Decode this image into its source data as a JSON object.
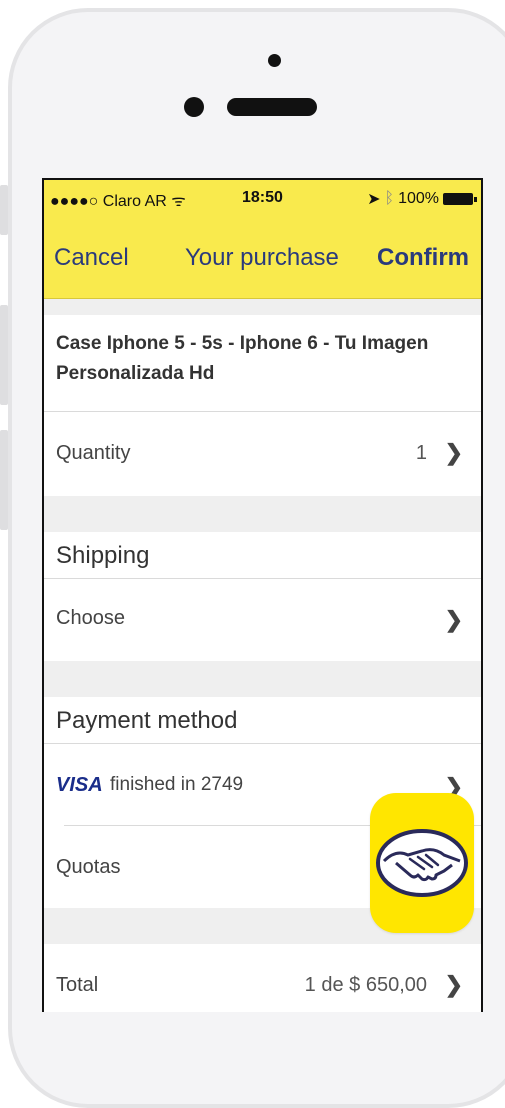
{
  "status_bar": {
    "carrier": "●●●●○ Claro AR",
    "time": "18:50",
    "battery": "100%"
  },
  "navbar": {
    "cancel": "Cancel",
    "title": "Your purchase",
    "confirm": "Confirm"
  },
  "product": {
    "title": "Case Iphone 5 - 5s - Iphone 6 - Tu Imagen Personalizada Hd"
  },
  "quantity": {
    "label": "Quantity",
    "value": "1"
  },
  "shipping": {
    "title": "Shipping",
    "choose": "Choose"
  },
  "payment": {
    "title": "Payment method",
    "card_brand": "VISA",
    "card_text": "finished in 2749",
    "quotas_label": "Quotas"
  },
  "total": {
    "label": "Total",
    "value": "1 de $ 650,00"
  },
  "colors": {
    "header_yellow": "#f9ea4d",
    "nav_text": "#2a3a7c",
    "logo_yellow": "#ffe600"
  }
}
